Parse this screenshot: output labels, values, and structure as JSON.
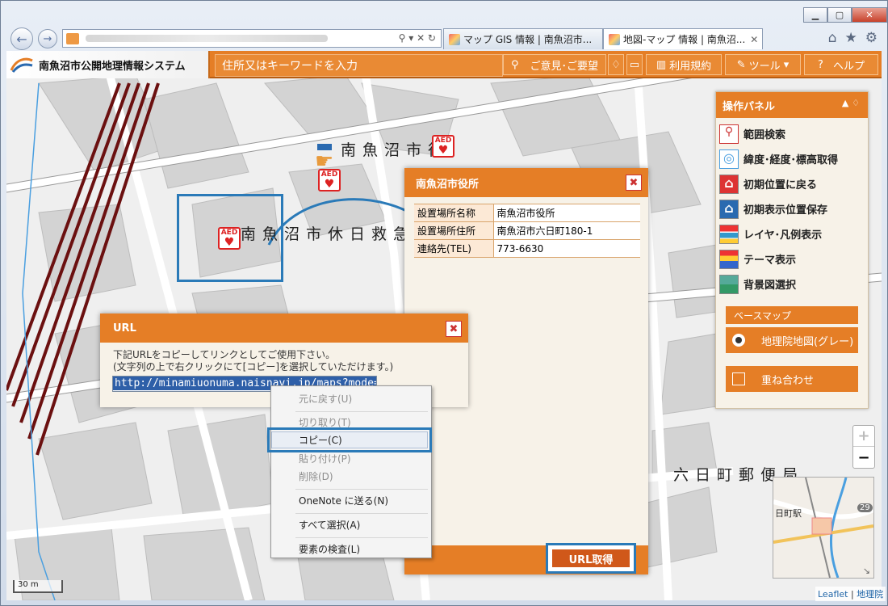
{
  "browser": {
    "tabs": [
      {
        "label": "マップ GIS 情報 | 南魚沼市..."
      },
      {
        "label": "地図-マップ 情報 | 南魚沼..."
      }
    ]
  },
  "app": {
    "title": "南魚沼市公開地理情報システム",
    "search_placeholder": "住所又はキーワードを入力",
    "header_buttons": {
      "opinion": "ご意見･ご要望",
      "terms": "利用規約",
      "tools": "ツール",
      "help": "ヘルプ"
    }
  },
  "panel": {
    "title": "操作パネル",
    "items": [
      {
        "label": "範囲検索",
        "icon": "magnifier-icon"
      },
      {
        "label": "緯度･経度･標高取得",
        "icon": "target-icon"
      },
      {
        "label": "初期位置に戻る",
        "icon": "home-red-icon"
      },
      {
        "label": "初期表示位置保存",
        "icon": "home-blue-icon"
      },
      {
        "label": "レイヤ･凡例表示",
        "icon": "layers-icon"
      },
      {
        "label": "テーマ表示",
        "icon": "theme-icon"
      },
      {
        "label": "背景図選択",
        "icon": "landscape-icon"
      }
    ],
    "basemap_title": "ベースマップ",
    "basemap_selected": "地理院地図(グレー)",
    "overlay_label": "重ね合わせ"
  },
  "map": {
    "labels": {
      "cityhall": "南魚沼市役",
      "clinic": "南魚沼市休日救急",
      "post": "六日町郵便局"
    },
    "aed_text": "AED",
    "scale": "30 m",
    "minimap": {
      "station": "日町駅",
      "route": "29"
    },
    "attribution": {
      "leaflet": "Leaflet",
      "sep": " | ",
      "gsi": "地理院"
    }
  },
  "popup": {
    "title": "南魚沼市役所",
    "rows": [
      {
        "key": "設置場所名称",
        "value": "南魚沼市役所"
      },
      {
        "key": "設置場所住所",
        "value": "南魚沼市六日町180-1"
      },
      {
        "key": "連絡先(TEL)",
        "value": "773-6630"
      }
    ],
    "url_button": "URL取得"
  },
  "url_dialog": {
    "title": "URL",
    "line1": "下記URLをコピーしてリンクとしてご使用下さい。",
    "line2": "(文字列の上で右クリックにて[コピー]を選択していただけます。)",
    "url": "http://minamiuonuma.naisnavi.jp/maps?mode="
  },
  "context_menu": {
    "items": [
      {
        "label": "元に戻す(U)",
        "disabled": true
      },
      {
        "label": "切り取り(T)",
        "disabled": true
      },
      {
        "label": "コピー(C)",
        "disabled": false
      },
      {
        "label": "貼り付け(P)",
        "disabled": true
      },
      {
        "label": "削除(D)",
        "disabled": true
      },
      {
        "label": "OneNote に送る(N)",
        "disabled": false
      },
      {
        "label": "すべて選択(A)",
        "disabled": false
      },
      {
        "label": "要素の検査(L)",
        "disabled": false
      }
    ]
  },
  "colors": {
    "accent": "#e57e26",
    "highlight": "#2a7ab8",
    "railway": "#6b1010"
  }
}
